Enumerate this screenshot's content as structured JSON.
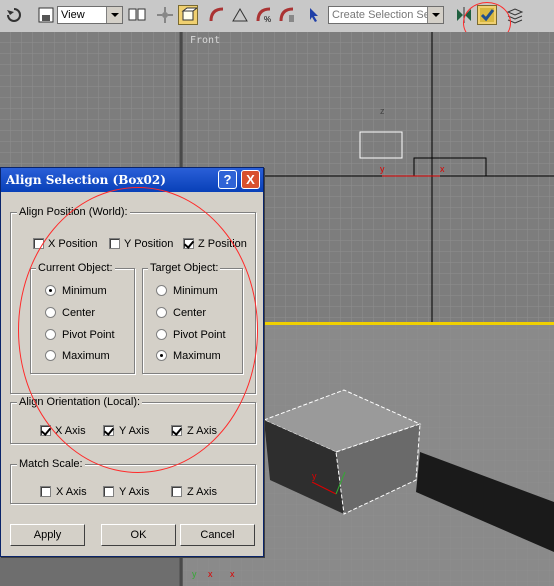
{
  "toolbar": {
    "view_dropdown": "View",
    "selection_set_placeholder": "Create Selection Set",
    "icons": [
      "undo-icon",
      "select-filter-icon",
      "mirror-icon",
      "align-icon",
      "layer-icon"
    ]
  },
  "viewport": {
    "front_label": "Front"
  },
  "dialog": {
    "title": "Align Selection (Box02)",
    "help_label": "?",
    "close_label": "X",
    "align_position": {
      "label": "Align Position (World):",
      "x": {
        "label": "X Position",
        "checked": false
      },
      "y": {
        "label": "Y Position",
        "checked": false
      },
      "z": {
        "label": "Z Position",
        "checked": true
      }
    },
    "current_object": {
      "label": "Current Object:",
      "options": [
        "Minimum",
        "Center",
        "Pivot Point",
        "Maximum"
      ],
      "selected": "Minimum"
    },
    "target_object": {
      "label": "Target Object:",
      "options": [
        "Minimum",
        "Center",
        "Pivot Point",
        "Maximum"
      ],
      "selected": "Maximum"
    },
    "align_orientation": {
      "label": "Align Orientation (Local):",
      "x": {
        "label": "X Axis",
        "checked": true
      },
      "y": {
        "label": "Y Axis",
        "checked": true
      },
      "z": {
        "label": "Z Axis",
        "checked": true
      }
    },
    "match_scale": {
      "label": "Match Scale:",
      "x": {
        "label": "X Axis",
        "checked": false
      },
      "y": {
        "label": "Y Axis",
        "checked": false
      },
      "z": {
        "label": "Z Axis",
        "checked": false
      }
    },
    "buttons": {
      "apply": "Apply",
      "ok": "OK",
      "cancel": "Cancel"
    }
  },
  "axes": {
    "x": "x",
    "y": "y",
    "z": "z"
  },
  "colors": {
    "annotation": "#ff2a2a",
    "active_viewport": "#f0d000",
    "title_bar": "#0840b8"
  }
}
